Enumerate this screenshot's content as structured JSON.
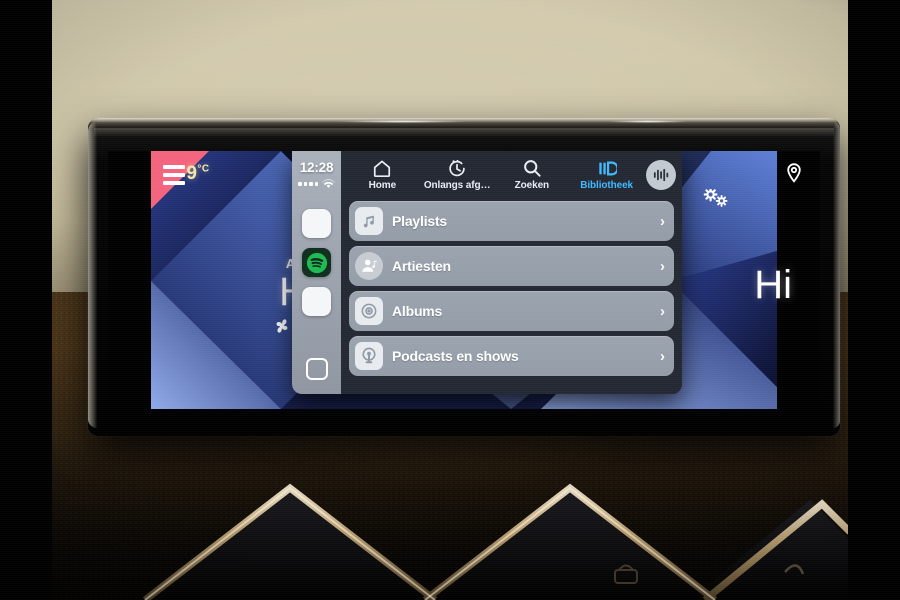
{
  "scene": {
    "description": "Car infotainment head unit photo showing Apple CarPlay Spotify library screen"
  },
  "vehicle_ui": {
    "menu_icon": "hamburger-menu-icon",
    "temperature": "9",
    "temperature_unit": "°C",
    "climate": {
      "ac_label": "A/C",
      "level_left": "Hi",
      "level_right": "Hi",
      "fan_icon": "fan-icon",
      "seat_icon": "seat-airflow-icon"
    },
    "right_icons": {
      "location_pin": "location-pin-icon",
      "gears": "gears-icon"
    }
  },
  "carplay": {
    "rail": {
      "clock": "12:28",
      "signal_icon": "signal-dots-icon",
      "wifi_icon": "wifi-icon",
      "apps": [
        {
          "name": "app-icon-blank-top",
          "label": "",
          "color": "#f4f6f8"
        },
        {
          "name": "app-icon-spotify",
          "label": "Spotify",
          "color": "#1db954"
        },
        {
          "name": "app-icon-blank-bottom",
          "label": "",
          "color": "#f4f6f8"
        }
      ],
      "home_button": "home-button-icon"
    },
    "tabs": [
      {
        "label": "Home",
        "icon": "house-icon",
        "active": false
      },
      {
        "label": "Onlangs afg…",
        "icon": "recently-played-clock-icon",
        "active": false
      },
      {
        "label": "Zoeken",
        "icon": "search-icon",
        "active": false
      },
      {
        "label": "Bibliotheek",
        "icon": "library-bars-icon",
        "active": true
      }
    ],
    "now_playing_icon": "now-playing-waveform-icon",
    "active_tab_color": "#3fb8ff",
    "list": [
      {
        "label": "Playlists",
        "icon": "music-note-icon",
        "chevron": "›"
      },
      {
        "label": "Artiesten",
        "icon": "artist-person-icon",
        "chevron": "›"
      },
      {
        "label": "Albums",
        "icon": "album-disc-icon",
        "chevron": "›"
      },
      {
        "label": "Podcasts en shows",
        "icon": "podcast-mic-icon",
        "chevron": "›"
      }
    ]
  }
}
